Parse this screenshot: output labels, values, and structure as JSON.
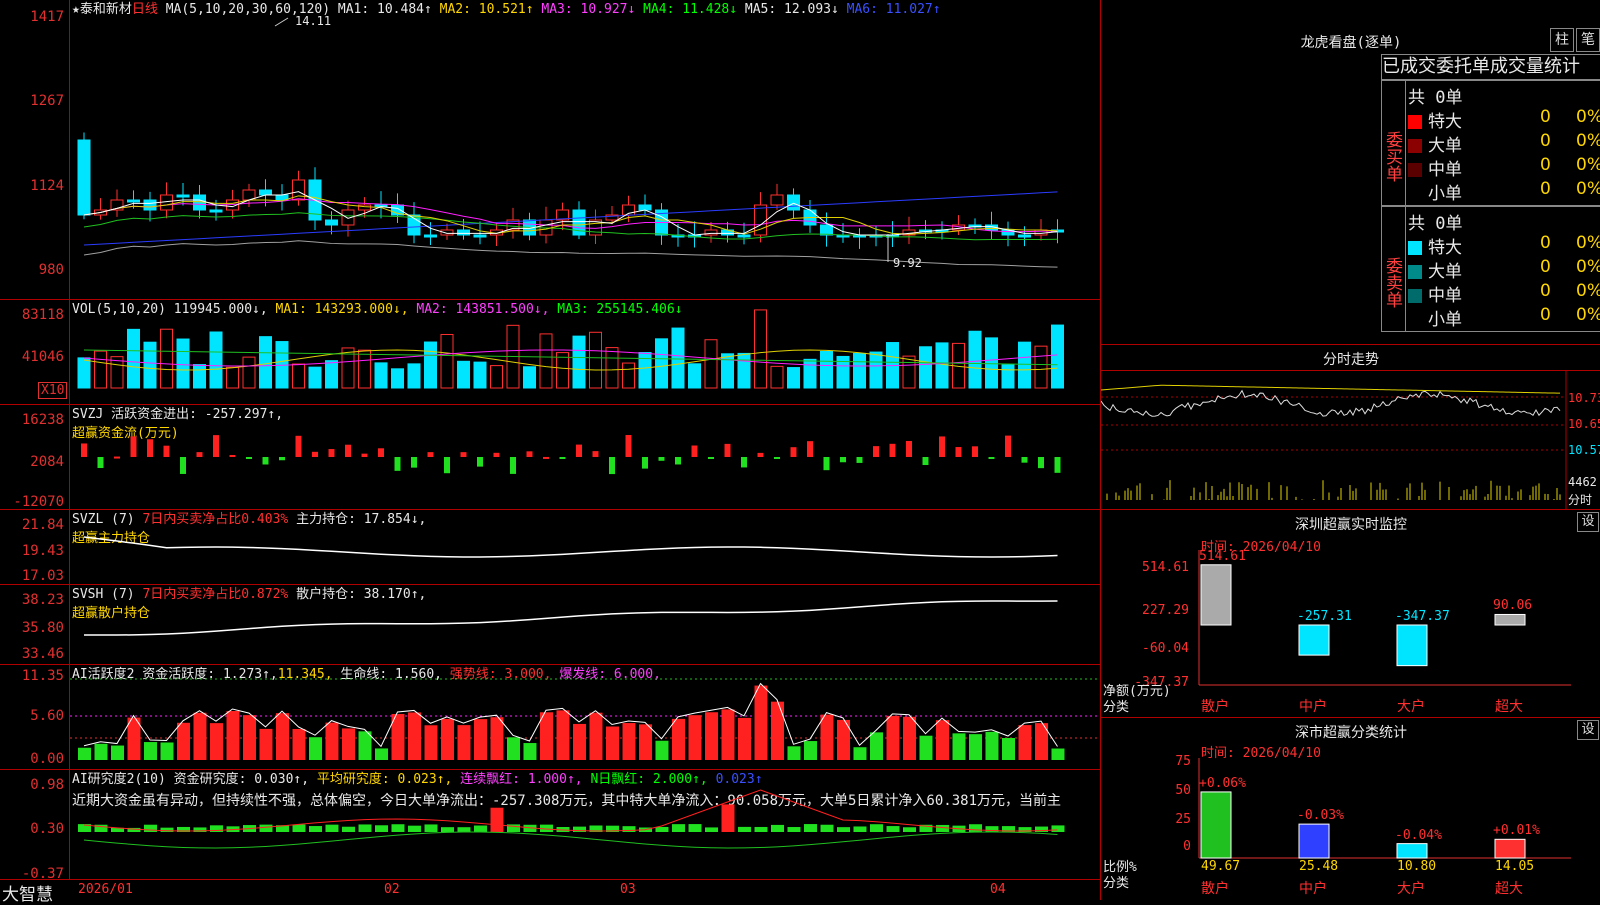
{
  "stock": {
    "star": "★",
    "name": "泰和新材",
    "period": "日线"
  },
  "ma": {
    "label": "MA(5,10,20,30,60,120)",
    "ma1": "MA1: 10.484↑",
    "ma2": "MA2: 10.521↑",
    "ma3": "MA3: 10.927↓",
    "ma4": "MA4: 11.428↓",
    "ma5": "MA5: 12.093↓",
    "ma6": "MA6: 11.027↑"
  },
  "price_axis": [
    "1417",
    "1267",
    "1124",
    "980"
  ],
  "annot": {
    "high": "14.11",
    "low": "9.92"
  },
  "vol": {
    "label": "VOL(5,10,20)",
    "val": "119945.000↓,",
    "ma1": "MA1: 143293.000↓,",
    "ma2": "MA2: 143851.500↓,",
    "ma3": "MA3: 255145.406↓",
    "axis": [
      "83118",
      "41046"
    ],
    "unit": "X10"
  },
  "svzj": {
    "label": "SVZJ  活跃资金进出: -257.297↑,",
    "sub": "超赢资金流(万元)",
    "axis": [
      "16238",
      "2084",
      "-12070"
    ]
  },
  "svzl": {
    "label": "SVZL (7)",
    "mid": "7日内买卖净占比0.403%",
    "hold": "主力持仓: 17.854↓,",
    "sub": "超赢主力持仓",
    "axis": [
      "21.84",
      "19.43",
      "17.03"
    ]
  },
  "svsh": {
    "label": "SVSH (7)",
    "mid": "7日内买卖净占比0.872%",
    "hold": "散户持仓: 38.170↑,",
    "sub": "超赢散户持仓",
    "axis": [
      "38.23",
      "35.80",
      "33.46"
    ]
  },
  "ai1": {
    "label": "AI活跃度2 资金活跃度: 1.273↑,",
    "v2": "11.345,",
    "v3": "生命线: 1.560,",
    "v4": "强势线: 3.000,",
    "v5": "爆发线: 6.000,",
    "axis": [
      "11.35",
      "5.60",
      "0.00"
    ]
  },
  "ai2": {
    "label": "AI研究度2(10) 资金研究度: 0.030↑,",
    "v2": "平均研究度: 0.023↑,",
    "v3": "连续飘红: 1.000↑,",
    "v4": "N日飘红: 2.000↑,",
    "v5": "0.023↑",
    "note": "近期大资金虽有异动，但持续性不强，总体偏空，今日大单净流出：-257.308万元，其中特大单净流入：90.058万元，大单5日累计净入60.381万元，当前主",
    "axis": [
      "0.98",
      "0.30",
      "-0.37"
    ]
  },
  "dates": [
    "2026/01",
    "02",
    "03",
    "04"
  ],
  "brand": "大智慧",
  "lhb": {
    "title": "龙虎看盘(逐单)",
    "btn1": "柱",
    "btn2": "笔",
    "tabs": [
      "已成交",
      "委托单",
      "成交量",
      "统计"
    ],
    "buy": {
      "side": "委买单",
      "total": "共 0单",
      "rows": [
        {
          "name": "特大",
          "n": "0",
          "p": "0%"
        },
        {
          "name": "大单",
          "n": "0",
          "p": "0%"
        },
        {
          "name": "中单",
          "n": "0",
          "p": "0%"
        },
        {
          "name": "小单",
          "n": "0",
          "p": "0%"
        }
      ]
    },
    "sell": {
      "side": "委卖单",
      "total": "共 0单",
      "rows": [
        {
          "name": "特大",
          "n": "0",
          "p": "0%"
        },
        {
          "name": "大单",
          "n": "0",
          "p": "0%"
        },
        {
          "name": "中单",
          "n": "0",
          "p": "0%"
        },
        {
          "name": "小单",
          "n": "0",
          "p": "0%"
        }
      ]
    }
  },
  "fs": {
    "title": "分时走势",
    "p1": "10.73",
    "p2": "10.65",
    "p3": "10.57",
    "v": "4462",
    "unit": "分时"
  },
  "sz": {
    "title": "深圳超赢实时监控",
    "set": "设",
    "time": "时间: 2026/04/10",
    "axis": [
      "514.61",
      "227.29",
      "-60.04",
      "-347.37"
    ],
    "ylab": "净额(万元)",
    "xlab": "分类",
    "cats": [
      "散户",
      "中户",
      "大户",
      "超大"
    ],
    "vals": [
      "514.61",
      "-257.31",
      "-347.37",
      "90.06"
    ]
  },
  "fl": {
    "title": "深市超赢分类统计",
    "set": "设",
    "time": "时间: 2026/04/10",
    "axis": [
      "75",
      "50",
      "25",
      "0"
    ],
    "ylab": "比例%",
    "xlab": "分类",
    "cats": [
      "散户",
      "中户",
      "大户",
      "超大"
    ],
    "chg": [
      "+0.06%",
      "-0.03%",
      "-0.04%",
      "+0.01%"
    ],
    "vals": [
      "49.67",
      "25.48",
      "10.80",
      "14.05"
    ]
  }
}
